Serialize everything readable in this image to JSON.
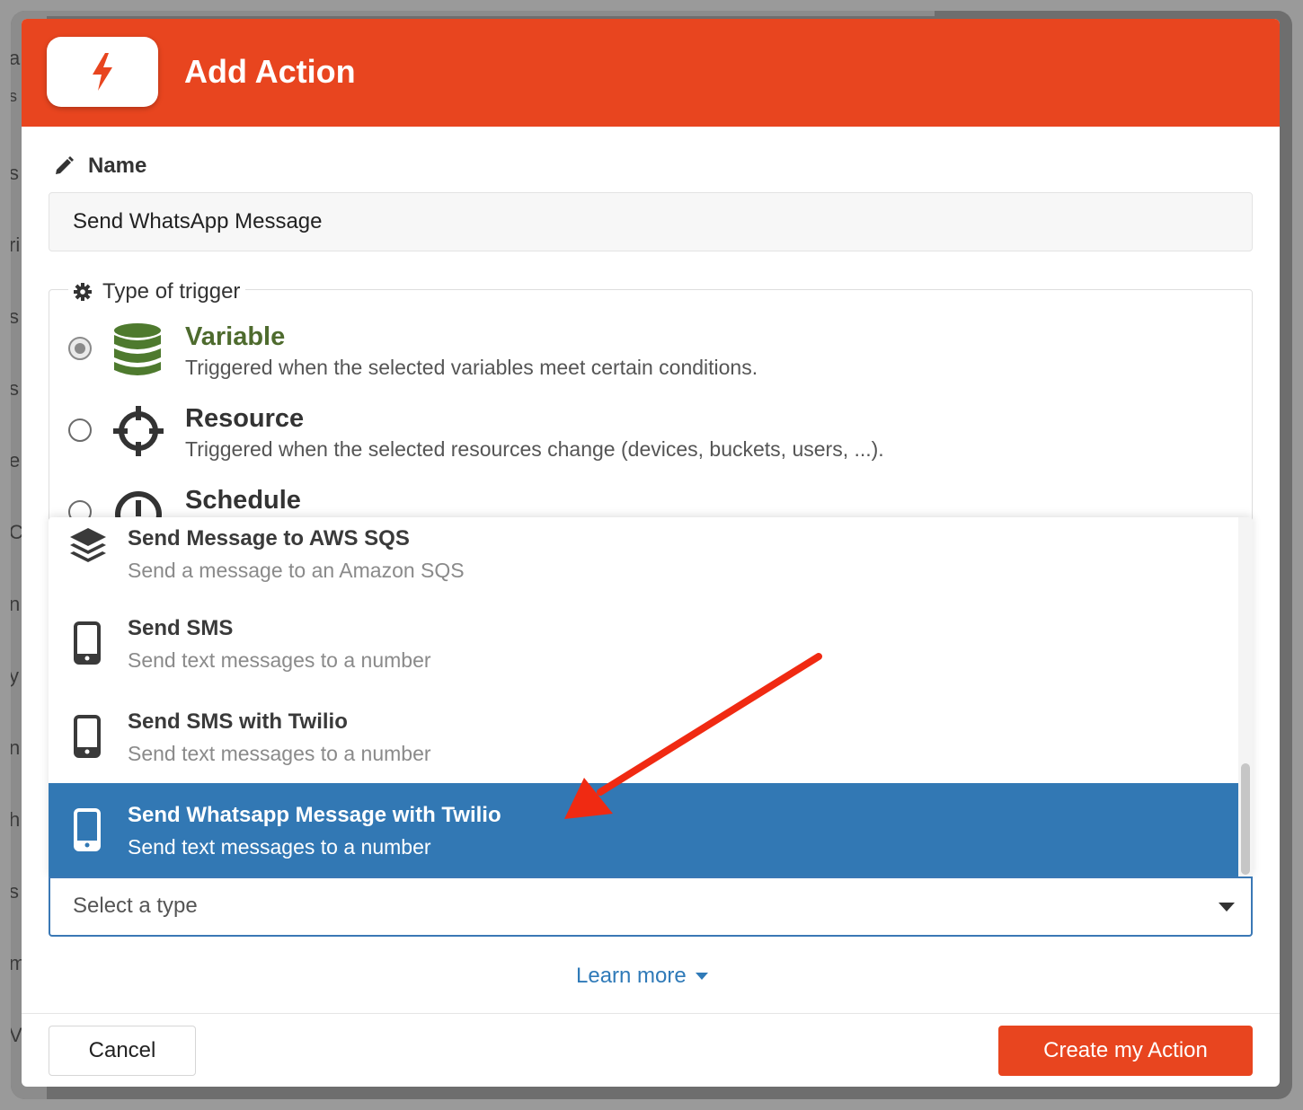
{
  "background": {
    "letters": [
      "a",
      "s",
      "s",
      "ri",
      "s",
      "s",
      "e",
      "C",
      "n",
      "y",
      "n",
      "h",
      "s",
      "m",
      "V"
    ]
  },
  "modal": {
    "title": "Add Action",
    "header_icon": "bolt-icon",
    "accent_color": "#e8451f"
  },
  "name": {
    "label": "Name",
    "icon": "pencil-icon",
    "value": "Send WhatsApp Message"
  },
  "trigger": {
    "legend": "Type of trigger",
    "legend_icon": "gear-icon",
    "options": [
      {
        "title": "Variable",
        "description": "Triggered when the selected variables meet certain conditions.",
        "icon": "database-icon",
        "selected": true
      },
      {
        "title": "Resource",
        "description": "Triggered when the selected resources change (devices, buckets, users, ...).",
        "icon": "crosshair-icon",
        "selected": false
      },
      {
        "title": "Schedule",
        "description": "",
        "icon": "clock-icon",
        "selected": false
      }
    ]
  },
  "action_type": {
    "placeholder": "Select a type",
    "options": [
      {
        "title": "Send Message to AWS SQS",
        "description": "Send a message to an Amazon SQS",
        "icon": "layers-icon",
        "highlighted": false
      },
      {
        "title": "Send SMS",
        "description": "Send text messages to a number",
        "icon": "mobile-phone-icon",
        "highlighted": false
      },
      {
        "title": "Send SMS with Twilio",
        "description": "Send text messages to a number",
        "icon": "mobile-phone-icon",
        "highlighted": false
      },
      {
        "title": "Send Whatsapp Message with Twilio",
        "description": "Send text messages to a number",
        "icon": "mobile-phone-icon",
        "highlighted": true
      }
    ],
    "highlight_color": "#3278b4"
  },
  "learn_more": {
    "label": "Learn more"
  },
  "footer": {
    "cancel_label": "Cancel",
    "create_label": "Create my Action"
  },
  "annotation": {
    "arrow_color": "#f02a12"
  }
}
